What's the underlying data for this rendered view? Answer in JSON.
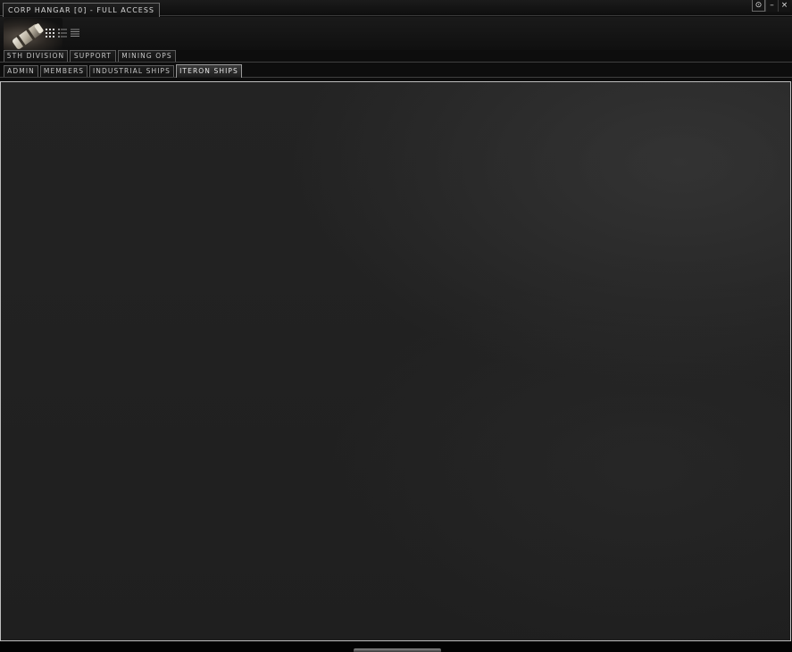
{
  "window": {
    "title": "CORP HANGAR [0] - FULL ACCESS",
    "controls": {
      "options_glyph": "⊙",
      "minimize_glyph": "–",
      "close_glyph": "×"
    }
  },
  "header": {
    "image": "hangar-container-image",
    "view_modes": [
      "icons-view-icon",
      "details-view-icon",
      "list-view-icon"
    ]
  },
  "division_tabs": [
    {
      "label": "5TH DIVISION",
      "active": false
    },
    {
      "label": "SUPPORT",
      "active": false
    },
    {
      "label": "MINING OPS",
      "active": false
    }
  ],
  "section_tabs": [
    {
      "label": "ADMIN",
      "active": false
    },
    {
      "label": "MEMBERS",
      "active": false
    },
    {
      "label": "INDUSTRIAL SHIPS",
      "active": false
    },
    {
      "label": "ITERON SHIPS",
      "active": true
    }
  ],
  "colors": {
    "accent_border": "#bdbdbd",
    "background": "#1f1f1f",
    "text": "#c8c8c8"
  }
}
